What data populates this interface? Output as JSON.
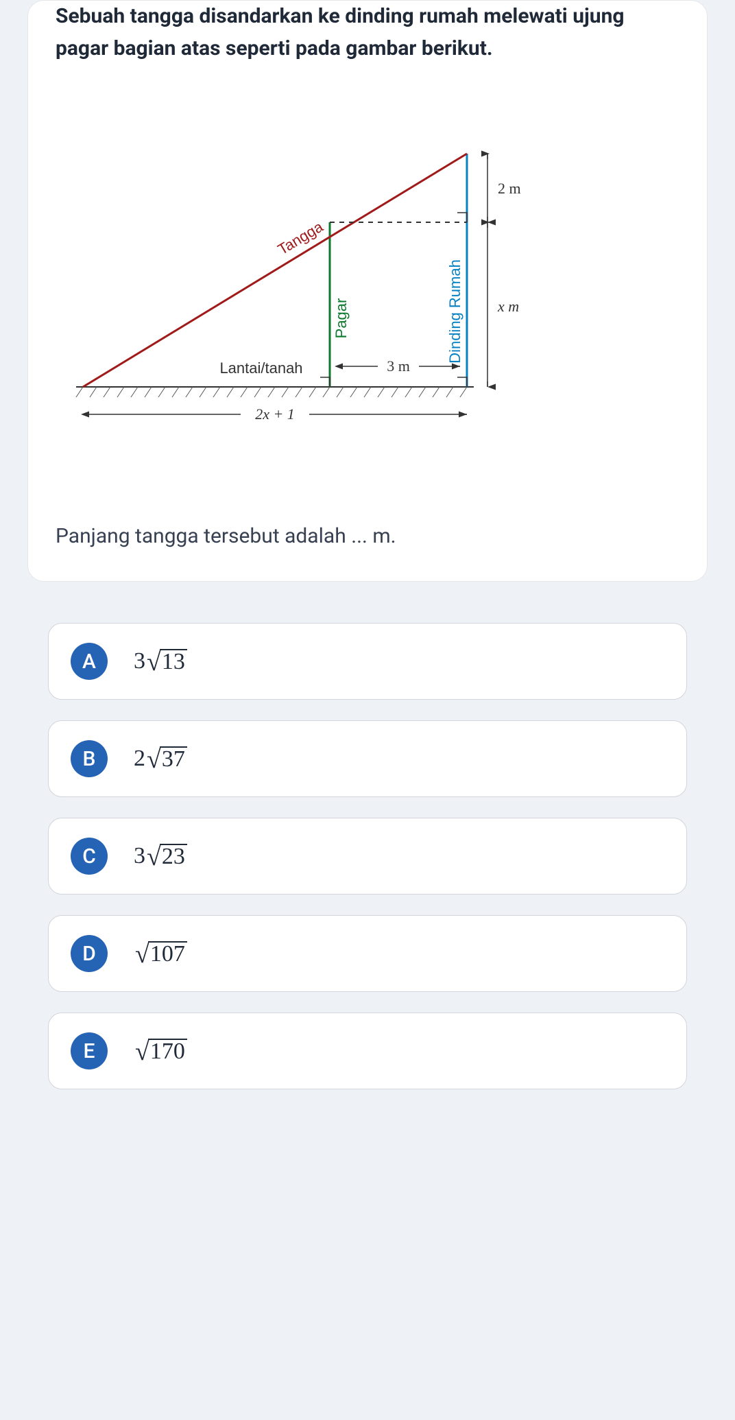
{
  "question": {
    "prompt": "Sebuah tangga disandarkan ke dinding rumah melewati ujung pagar bagian atas seperti pada gambar berikut.",
    "after": "Panjang tangga tersebut adalah ... m."
  },
  "diagram": {
    "tangga": "Tangga",
    "pagar": "Pagar",
    "dinding": "Dinding Rumah",
    "lantai": "Lantai/tanah",
    "dim_top": "2 m",
    "dim_right": "x m",
    "dim_gap": "3 m",
    "dim_base": "2x + 1"
  },
  "options": [
    {
      "letter": "A",
      "coef": "3",
      "rad": "13"
    },
    {
      "letter": "B",
      "coef": "2",
      "rad": "37"
    },
    {
      "letter": "C",
      "coef": "3",
      "rad": "23"
    },
    {
      "letter": "D",
      "coef": "",
      "rad": "107"
    },
    {
      "letter": "E",
      "coef": "",
      "rad": "170"
    }
  ],
  "chart_data": {
    "type": "diagram",
    "description": "Right triangle: ladder (Tangga) as hypotenuse from ground to top of wall (Dinding Rumah). A fence (Pagar) stands vertically 3 m from the wall and meets the ladder. Wall height = x + 2; top 2 m segment is above fence-top level. Ground base length = 2x + 1.",
    "labels": {
      "hypotenuse": "Tangga",
      "vertical_inner": "Pagar",
      "vertical_right": "Dinding Rumah",
      "base": "Lantai/tanah"
    },
    "dimensions": {
      "wall_top_segment_m": 2,
      "wall_bottom_segment": "x m",
      "fence_to_wall_m": 3,
      "base_total": "2x + 1"
    }
  }
}
